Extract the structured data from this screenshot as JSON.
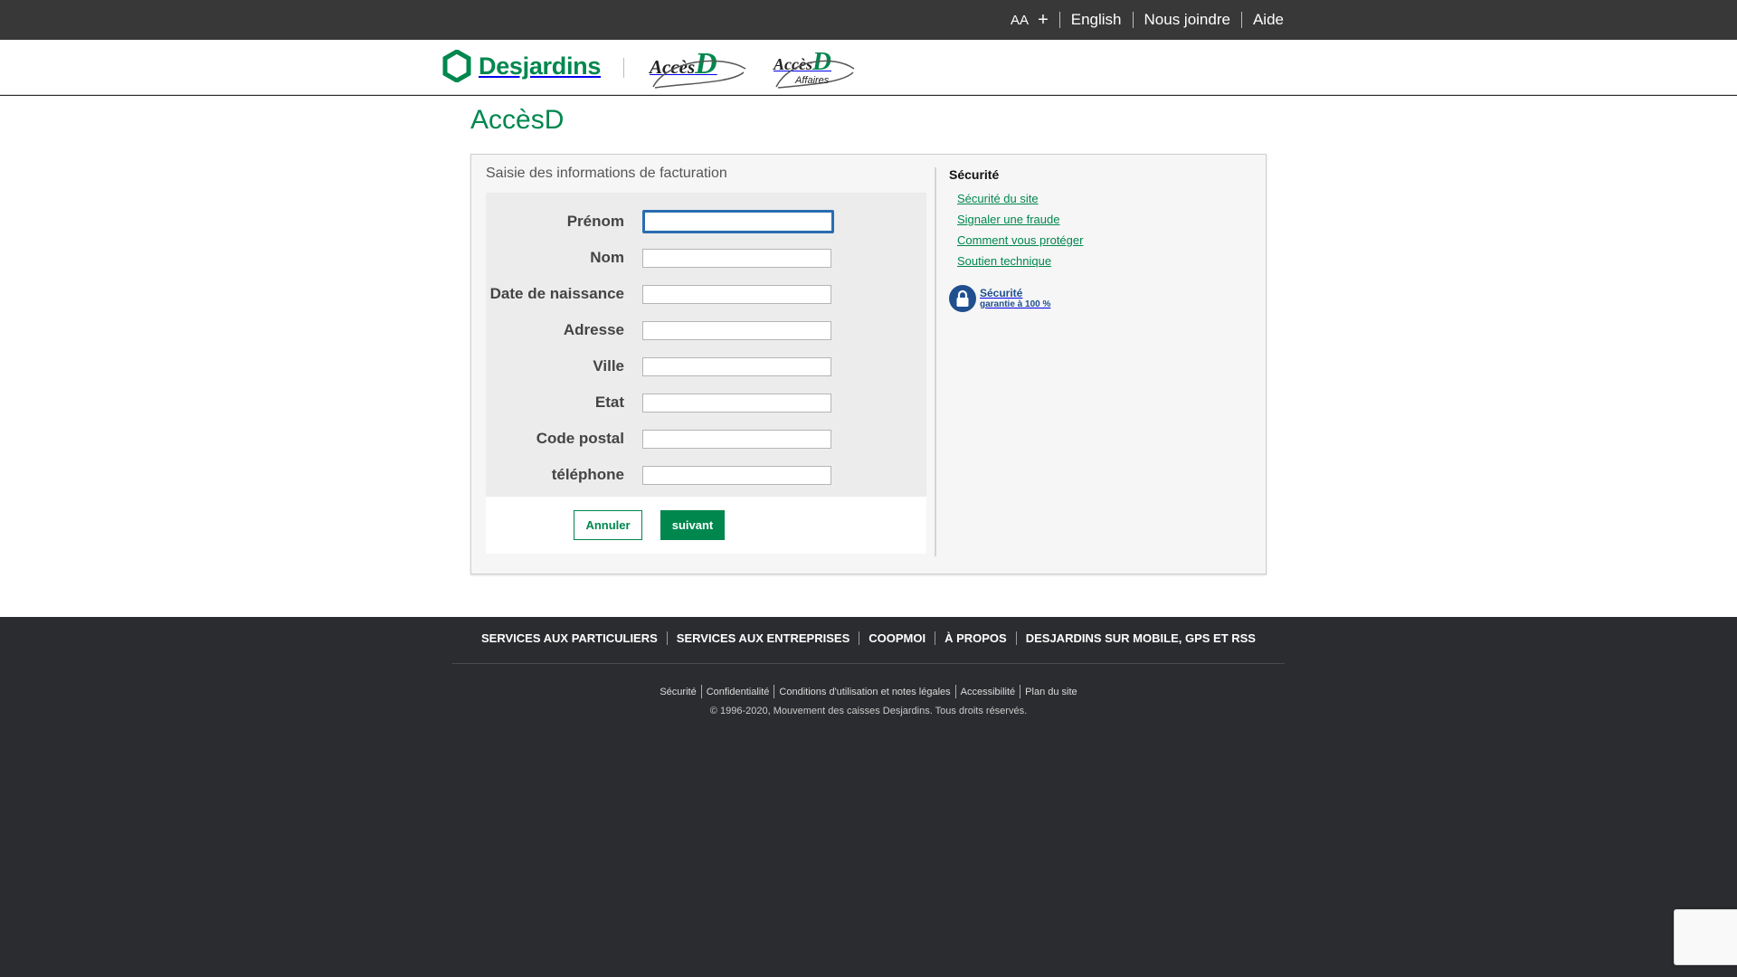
{
  "topbar": {
    "text_size_label": "AA",
    "text_size_plus": "+",
    "links": [
      "English",
      "Nous joindre",
      "Aide"
    ]
  },
  "header": {
    "logo_text": "Desjardins",
    "acces_text": "Accès",
    "acces_d": "D",
    "acces_affaires_text": "Accès",
    "acces_affaires_d": "D",
    "acces_affaires_sub": "Affaires"
  },
  "page": {
    "title": "AccèsD"
  },
  "form": {
    "title": "Saisie des informations de facturation",
    "fields": [
      {
        "label": "Prénom",
        "value": ""
      },
      {
        "label": "Nom",
        "value": ""
      },
      {
        "label": "Date de naissance",
        "value": ""
      },
      {
        "label": "Adresse",
        "value": ""
      },
      {
        "label": "Ville",
        "value": ""
      },
      {
        "label": "Etat",
        "value": ""
      },
      {
        "label": "Code postal",
        "value": ""
      },
      {
        "label": "téléphone",
        "value": ""
      }
    ],
    "cancel_label": "Annuler",
    "next_label": "suivant"
  },
  "sidebar": {
    "title": "Sécurité",
    "links": [
      "Sécurité du site",
      "Signaler une fraude",
      "Comment vous protéger",
      "Soutien technique"
    ],
    "badge_line1": "Sécurité",
    "badge_line2": "garantie à 100 %"
  },
  "footer": {
    "nav": [
      "SERVICES AUX PARTICULIERS",
      "SERVICES AUX ENTREPRISES",
      "COOPMOI",
      "À PROPOS",
      "DESJARDINS SUR MOBILE, GPS ET RSS"
    ],
    "links": [
      "Sécurité",
      "Confidentialité",
      "Conditions d'utilisation et notes légales",
      "Accessibilité",
      "Plan du site"
    ],
    "copyright": "© 1996-2020, Mouvement des caisses Desjardins. Tous droits réservés."
  },
  "colors": {
    "brand_green": "#00874e",
    "topbar": "#383838",
    "footer": "#2b2c2f",
    "focus_blue": "#2a6db0"
  }
}
